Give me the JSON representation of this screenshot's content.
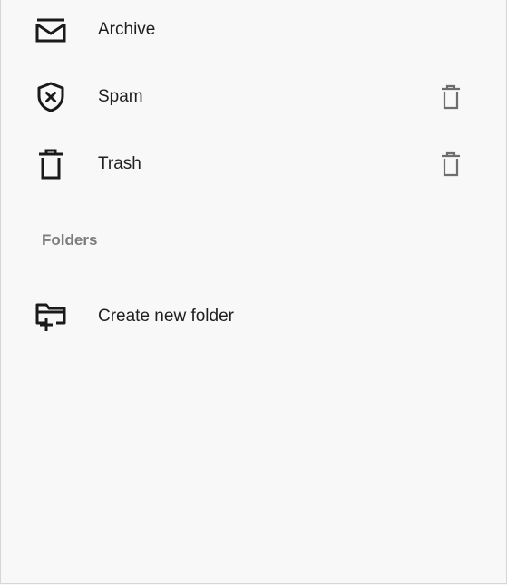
{
  "menu": {
    "items": [
      {
        "label": "Archive",
        "icon": "archive-icon",
        "has_delete": false
      },
      {
        "label": "Spam",
        "icon": "spam-shield-icon",
        "has_delete": true
      },
      {
        "label": "Trash",
        "icon": "trash-icon",
        "has_delete": true
      }
    ]
  },
  "folders": {
    "header": "Folders",
    "create_label": "Create new folder"
  },
  "colors": {
    "background": "#f8f8f8",
    "text": "#1f1f1f",
    "section_header": "#7c7c7c",
    "icon": "#1a1a1a",
    "action_icon": "#6e6e6e"
  }
}
